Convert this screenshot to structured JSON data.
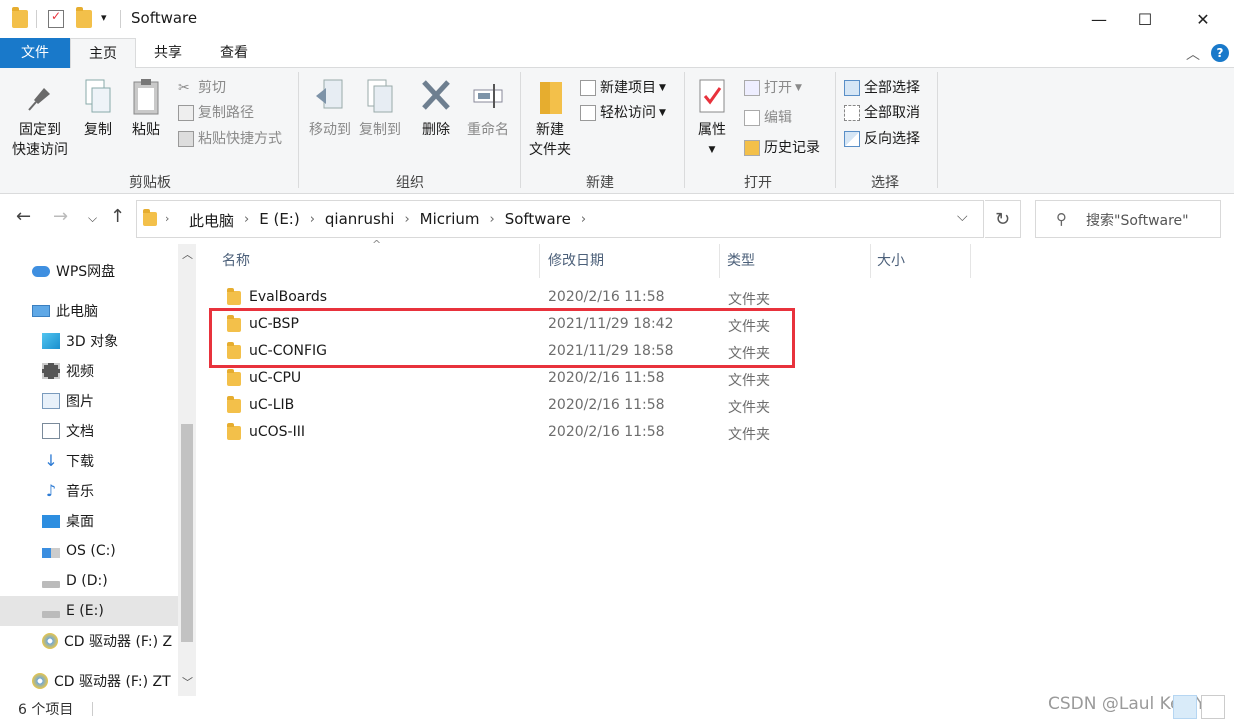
{
  "window": {
    "title": "Software",
    "controls": {
      "minimize": "—",
      "maximize": "☐",
      "close": "✕"
    }
  },
  "quick_access": {
    "dropdown": "▾"
  },
  "ribbon_tabs": [
    "文件",
    "主页",
    "共享",
    "查看"
  ],
  "ribbon": {
    "clipboard": {
      "label": "剪贴板",
      "pin": "固定到\n快速访问",
      "copy": "复制",
      "paste": "粘贴",
      "cut": "剪切",
      "copy_path": "复制路径",
      "paste_shortcut": "粘贴快捷方式"
    },
    "organize": {
      "label": "组织",
      "move_to": "移动到",
      "copy_to": "复制到",
      "delete": "删除",
      "rename": "重命名"
    },
    "new": {
      "label": "新建",
      "new_folder": "新建\n文件夹",
      "new_item": "新建项目",
      "easy_access": "轻松访问"
    },
    "open": {
      "label": "打开",
      "properties": "属性",
      "open": "打开",
      "edit": "编辑",
      "history": "历史记录"
    },
    "select": {
      "label": "选择",
      "select_all": "全部选择",
      "select_none": "全部取消",
      "invert": "反向选择"
    }
  },
  "address": {
    "breadcrumbs": [
      "此电脑",
      "E (E:)",
      "qianrushi",
      "Micrium",
      "Software"
    ],
    "search_placeholder": "搜索\"Software\""
  },
  "nav_pane": [
    {
      "label": "WPS网盘",
      "icon": "cloud-icon"
    },
    {
      "label": "此电脑",
      "icon": "computer-icon"
    },
    {
      "label": "3D 对象",
      "icon": "cube-icon"
    },
    {
      "label": "视频",
      "icon": "video-icon"
    },
    {
      "label": "图片",
      "icon": "picture-icon"
    },
    {
      "label": "文档",
      "icon": "document-icon"
    },
    {
      "label": "下载",
      "icon": "download-icon"
    },
    {
      "label": "音乐",
      "icon": "music-icon"
    },
    {
      "label": "桌面",
      "icon": "desktop-icon"
    },
    {
      "label": "OS (C:)",
      "icon": "drive-icon"
    },
    {
      "label": "D (D:)",
      "icon": "drive-icon"
    },
    {
      "label": "E (E:)",
      "icon": "drive-icon",
      "selected": true
    },
    {
      "label": "CD 驱动器 (F:) Z",
      "icon": "cd-icon"
    },
    {
      "label": "CD 驱动器 (F:) ZT",
      "icon": "cd-icon"
    }
  ],
  "columns": [
    "名称",
    "修改日期",
    "类型",
    "大小"
  ],
  "files": [
    {
      "name": "EvalBoards",
      "date": "2020/2/16 11:58",
      "type": "文件夹"
    },
    {
      "name": "uC-BSP",
      "date": "2021/11/29 18:42",
      "type": "文件夹"
    },
    {
      "name": "uC-CONFIG",
      "date": "2021/11/29 18:58",
      "type": "文件夹"
    },
    {
      "name": "uC-CPU",
      "date": "2020/2/16 11:58",
      "type": "文件夹"
    },
    {
      "name": "uC-LIB",
      "date": "2020/2/16 11:58",
      "type": "文件夹"
    },
    {
      "name": "uCOS-III",
      "date": "2020/2/16 11:58",
      "type": "文件夹"
    }
  ],
  "status": {
    "item_count": "6 个项目"
  },
  "watermark": "CSDN @Laul Ken-Yi",
  "colors": {
    "accent": "#1979ca",
    "folder": "#f3c04a",
    "highlight": "#e8323c"
  }
}
